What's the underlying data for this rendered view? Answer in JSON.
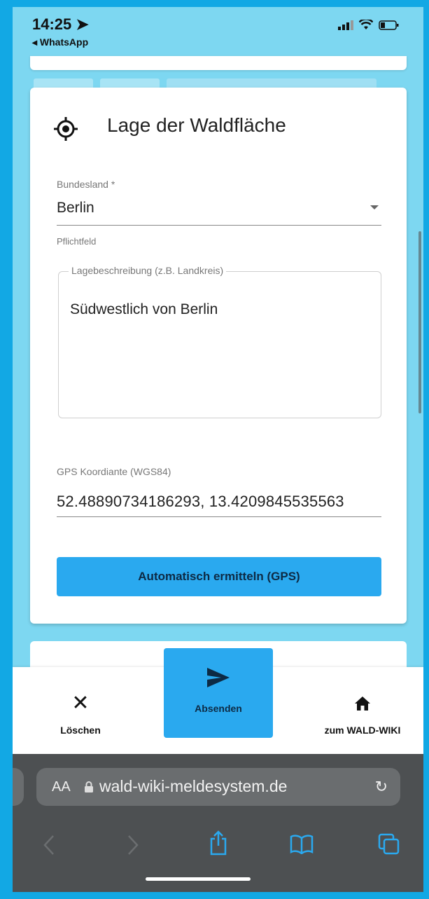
{
  "status_bar": {
    "time": "14:25",
    "back_app": "◂ WhatsApp"
  },
  "card": {
    "title": "Lage der Waldfläche",
    "bundesland": {
      "label": "Bundesland *",
      "value": "Berlin",
      "helper": "Pflichtfeld"
    },
    "lagebeschreibung": {
      "label": "Lagebeschreibung (z.B. Landkreis)",
      "value": "Südwestlich von Berlin"
    },
    "gps": {
      "label": "GPS Koordiante (WGS84)",
      "value": "52.48890734186293, 13.4209845535563"
    },
    "auto_button": "Automatisch ermitteln (GPS)"
  },
  "bottom_nav": {
    "delete_label": "Löschen",
    "send_label": "Absenden",
    "wiki_label": "zum WALD-WIKI"
  },
  "browser": {
    "aa_label": "AA",
    "url": "wald-wiki-meldesystem.de"
  },
  "colors": {
    "accent": "#2aa9ef",
    "background": "#7dd7f1",
    "card": "#ffffff",
    "browser_chrome": "#4d5052"
  }
}
